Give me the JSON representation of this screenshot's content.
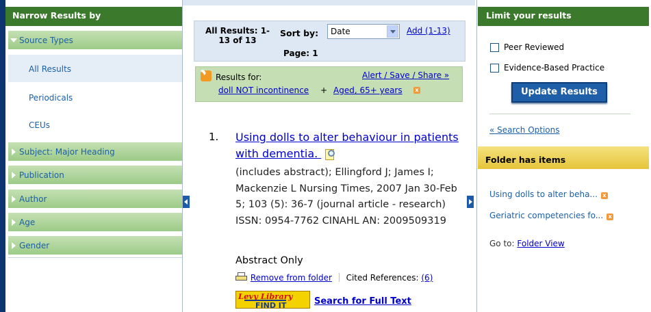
{
  "left_panel": {
    "heading": "Narrow Results by",
    "source_types": "Source Types",
    "items": [
      "All Results",
      "Periodicals",
      "CEUs"
    ],
    "facets": [
      "Subject: Major Heading",
      "Publication",
      "Author",
      "Age",
      "Gender"
    ]
  },
  "center": {
    "all_results": "All Results: 1-\n13 of 13",
    "sort_by_label": "Sort by:",
    "sort_value": "Date",
    "add_link": "Add (1-13)",
    "page_label": "Page: 1",
    "results_for_label": "Results for:",
    "alert_link": "Alert / Save / Share »",
    "query_terms": [
      "doll NOT incontinence",
      "Aged, 65+ years"
    ],
    "query_plus": "+",
    "result": {
      "number": "1.",
      "title": "Using dolls to alter behaviour in patients with dementia.",
      "body": "(includes abstract); Ellingford J; James I; Mackenzie L Nursing Times, 2007 Jan 30-Feb 5; 103 (5): 36-7 (journal article - research) ISSN: 0954-7762 CINAHL AN: 2009509319",
      "abstract": "Abstract Only",
      "remove_folder": "Remove from folder",
      "cited_refs_label": "Cited References:",
      "cited_refs_count": "(6)",
      "findit_logo_line1": "Levy Library",
      "findit_logo_line2": "FIND IT",
      "search_full_text": "Search for Full Text"
    }
  },
  "right_panel": {
    "heading": "Limit your results",
    "checkboxes": [
      "Peer Reviewed",
      "Evidence-Based Practice"
    ],
    "update_button": "Update Results",
    "search_options": "« Search Options",
    "folder_heading": "Folder has items",
    "folder_items": [
      "Using dolls to alter beha...",
      "Geriatric competencies fo..."
    ],
    "goto_label": "Go to:",
    "folder_view": "Folder View"
  },
  "colors": {
    "green_header": "#3b7a2c",
    "facet_green": "#9ccb87",
    "link_blue": "#0000cc",
    "nav_blue": "#1b5fa8",
    "button_blue": "#1e5fa8",
    "folder_yellow": "#e6c43a"
  },
  "icons": [
    "rss-icon",
    "magnifier-preview-icon",
    "printer-folder-icon",
    "remove-x-icon",
    "triangle-right-icon",
    "triangle-down-icon",
    "collapse-left-icon",
    "collapse-right-icon"
  ]
}
